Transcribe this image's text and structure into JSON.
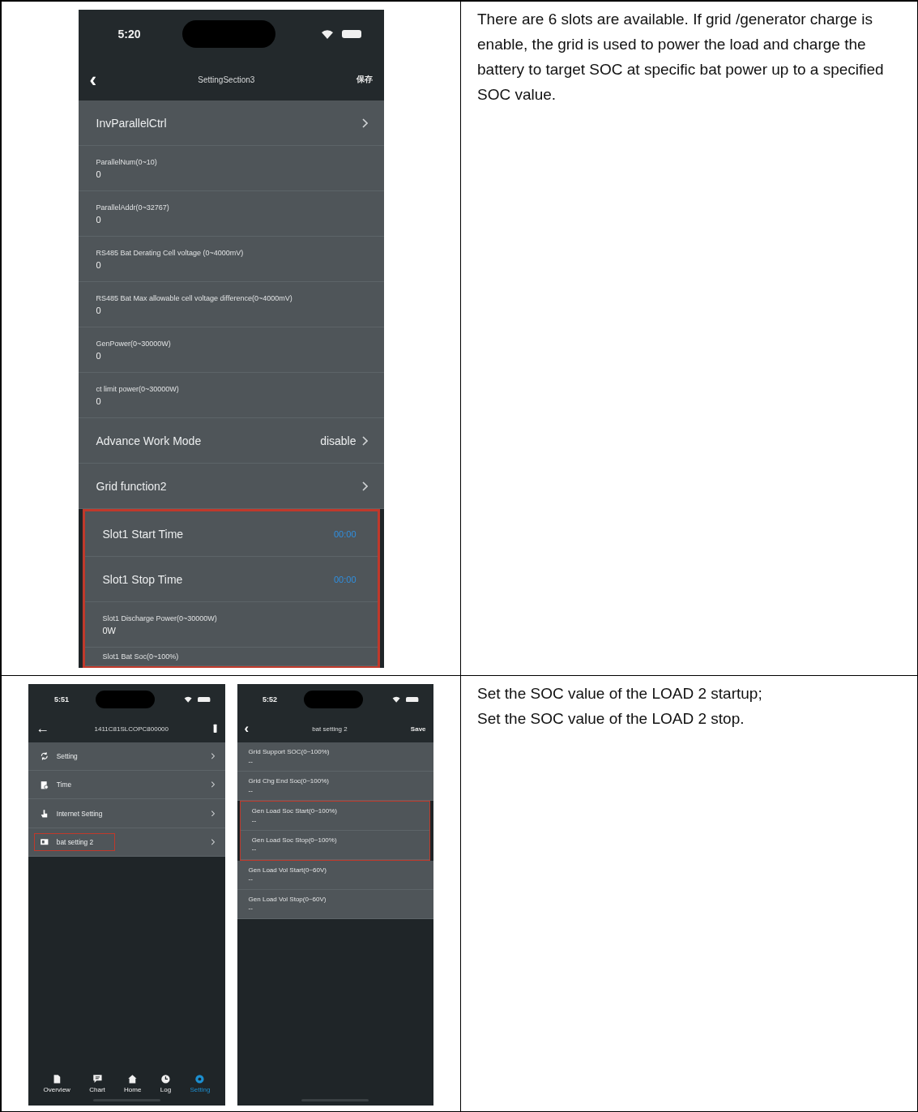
{
  "rows": [
    {
      "screens": [
        {
          "time": "5:20",
          "title": "SettingSection3",
          "back": "‹",
          "action": {
            "kind": "text",
            "text": "保存"
          },
          "items": [
            {
              "kind": "link",
              "label": "InvParallelCtrl",
              "highlighted": false
            },
            {
              "kind": "field",
              "label": "ParallelNum(0~10)",
              "value": "0",
              "highlighted": false
            },
            {
              "kind": "field",
              "label": "ParallelAddr(0~32767)",
              "value": "0",
              "highlighted": false
            },
            {
              "kind": "field",
              "label": "RS485 Bat Derating Cell voltage (0~4000mV)",
              "value": "0",
              "highlighted": false
            },
            {
              "kind": "field",
              "label": "RS485 Bat Max allowable cell voltage difference(0~4000mV)",
              "value": "0",
              "highlighted": false
            },
            {
              "kind": "field",
              "label": "GenPower(0~30000W)",
              "value": "0",
              "highlighted": false
            },
            {
              "kind": "field",
              "label": "ct limit power(0~30000W)",
              "value": "0",
              "highlighted": false
            },
            {
              "kind": "link",
              "label": "Advance Work Mode",
              "value": "disable",
              "highlighted": false
            },
            {
              "kind": "link",
              "label": "Grid function2",
              "highlighted": false
            },
            {
              "kind": "time",
              "label": "Slot1 Start Time",
              "value": "00:00",
              "highlighted": true
            },
            {
              "kind": "time",
              "label": "Slot1 Stop Time",
              "value": "00:00",
              "highlighted": true
            },
            {
              "kind": "field",
              "label": "Slot1 Discharge Power(0~30000W)",
              "value": "0W",
              "highlighted": true
            },
            {
              "kind": "field",
              "label": "Slot1 Bat Soc(0~100%)",
              "highlighted": true
            }
          ]
        }
      ],
      "description": [
        "There are 6 slots are available. If grid /generator charge is enable, the grid is used to power the load and charge the battery to target SOC at specific bat power up to a specified SOC value."
      ]
    },
    {
      "screens": [
        {
          "time": "5:51",
          "title": "1411C81SLCOPC800000",
          "back": "←",
          "action": {
            "kind": "icon"
          },
          "items": [
            {
              "kind": "menu",
              "label": "Setting",
              "highlighted": false
            },
            {
              "kind": "menu",
              "label": "Time",
              "highlighted": false
            },
            {
              "kind": "menu",
              "label": "Internet Setting",
              "highlighted": false
            },
            {
              "kind": "menu",
              "label": "bat setting 2",
              "highlighted": true
            }
          ],
          "tabs": [
            {
              "label": "Overview",
              "selected": false
            },
            {
              "label": "Chart",
              "selected": false
            },
            {
              "label": "Home",
              "selected": false
            },
            {
              "label": "Log",
              "selected": false
            },
            {
              "label": "Setting",
              "selected": true
            }
          ]
        },
        {
          "time": "5:52",
          "title": "bat setting 2",
          "back": "‹",
          "action": {
            "kind": "text",
            "text": "Save"
          },
          "items": [
            {
              "kind": "field",
              "label": "Grid Support SOC(0~100%)",
              "value": "--",
              "highlighted": false
            },
            {
              "kind": "field",
              "label": "Grid Chg End Soc(0~100%)",
              "value": "--",
              "highlighted": false
            },
            {
              "kind": "field",
              "label": "Gen Load Soc Start(0~100%)",
              "value": "--",
              "highlighted": true
            },
            {
              "kind": "field",
              "label": "Gen Load Soc Stop(0~100%)",
              "value": "--",
              "highlighted": true
            },
            {
              "kind": "field",
              "label": "Gen Load Vol Start(0~60V)",
              "value": "--",
              "highlighted": false
            },
            {
              "kind": "field",
              "label": "Gen Load Vol Stop(0~60V)",
              "value": "--",
              "highlighted": false
            }
          ]
        }
      ],
      "description": [
        "Set the SOC value of the LOAD 2 startup;",
        "Set the SOC value of the LOAD 2 stop."
      ]
    }
  ]
}
